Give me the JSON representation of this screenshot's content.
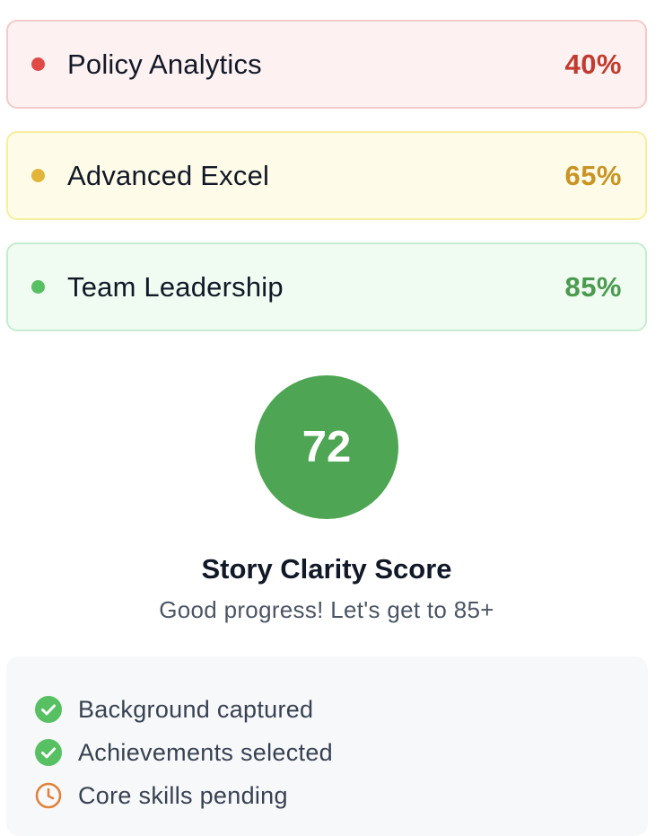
{
  "skills": [
    {
      "name": "Policy Analytics",
      "percent": "40%",
      "color": "#c23b2f",
      "dot_color": "#e04a45",
      "level": "low"
    },
    {
      "name": "Advanced Excel",
      "percent": "65%",
      "color": "#c99325",
      "dot_color": "#e2b43a",
      "level": "mid"
    },
    {
      "name": "Team Leadership",
      "percent": "85%",
      "color": "#4a9a4f",
      "dot_color": "#56c062",
      "level": "high"
    }
  ],
  "score": {
    "value": "72",
    "title": "Story Clarity Score",
    "subtitle": "Good progress! Let's get to 85+",
    "color": "#4ea553"
  },
  "checklist": [
    {
      "label": "Background captured",
      "icon": "check-circle-icon",
      "status": "done"
    },
    {
      "label": "Achievements selected",
      "icon": "check-circle-icon",
      "status": "done"
    },
    {
      "label": "Core skills pending",
      "icon": "clock-icon",
      "status": "pending"
    }
  ]
}
